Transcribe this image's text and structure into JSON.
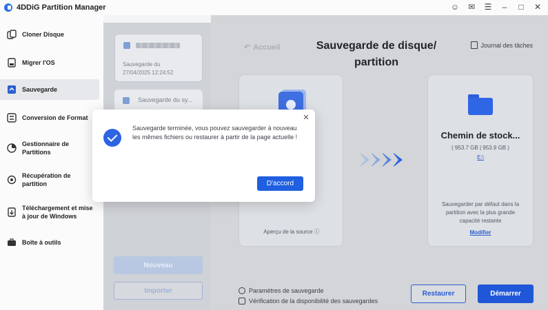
{
  "app": {
    "title": "4DDiG Partition Manager"
  },
  "window_controls": [
    "user-icon",
    "feedback-icon",
    "menu-icon",
    "minimize-icon",
    "maximize-icon",
    "close-icon"
  ],
  "sidebar": {
    "items": [
      {
        "label": "Cloner Disque",
        "icon": "clone-icon",
        "active": false
      },
      {
        "label": "Migrer l'OS",
        "icon": "migrate-icon",
        "active": false
      },
      {
        "label": "Sauvegarde",
        "icon": "backup-icon",
        "active": true
      },
      {
        "label": "Conversion de Format",
        "icon": "convert-icon",
        "active": false
      },
      {
        "label": "Gestionnaire de Partitions",
        "icon": "partition-icon",
        "active": false
      },
      {
        "label": "Récupération de partition",
        "icon": "recovery-icon",
        "active": false
      },
      {
        "label": "Téléchargement et mise à jour de Windows",
        "icon": "windows-update-icon",
        "active": false
      },
      {
        "label": "Boîte à outils",
        "icon": "toolbox-icon",
        "active": false
      }
    ]
  },
  "backup_list": {
    "card1_line1": "Sauvegarde du",
    "card1_line2": "27/04/2025 12:24:52",
    "card2_label": "Sauvegarde du sy...",
    "new_button": "Nouveau",
    "import_button": "Importer"
  },
  "main": {
    "back_label": "Accueil",
    "title": "Sauvegarde de disque/ partition",
    "journal_label": "Journal des tâches",
    "source_preview": "Aperçu de la source",
    "dest_name": "Chemin de stock...",
    "dest_size": "( 953.7 GB | 953.9 GB )",
    "dest_drive": "E:\\",
    "dest_desc": "Sauvegarder par défaut dans la partition avec la plus grande capacité restante",
    "dest_modify": "Modifier",
    "option_params": "Paramètres de sauvegarde",
    "option_verify": "Vérification de la disponibilité des sauvegardes",
    "restore_button": "Restaurer",
    "start_button": "Démarrer"
  },
  "dialog": {
    "message": "Sauvegarde terminée, vous pouvez sauvegarder à nouveau les mêmes fichiers ou restaurer à partir de la page actuelle !",
    "ok_button": "D'accord"
  },
  "colors": {
    "accent": "#1f57d8",
    "active_item": "#e6e8ec"
  }
}
